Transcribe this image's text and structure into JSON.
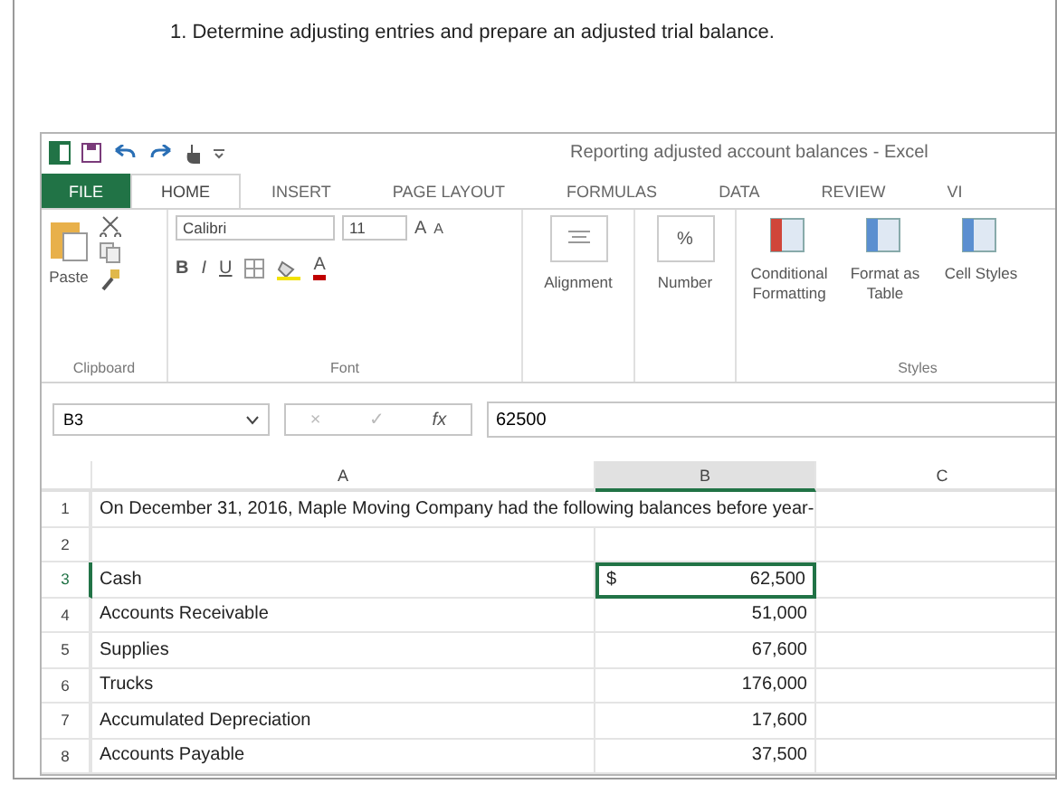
{
  "question": "1. Determine adjusting entries and prepare an adjusted trial balance.",
  "window": {
    "title": "Reporting adjusted account balances - Excel"
  },
  "tabs": [
    {
      "label": "FILE",
      "kind": "file",
      "selected": false
    },
    {
      "label": "HOME",
      "kind": "tab",
      "selected": true
    },
    {
      "label": "INSERT",
      "kind": "tab",
      "selected": false
    },
    {
      "label": "PAGE LAYOUT",
      "kind": "tab",
      "selected": false
    },
    {
      "label": "FORMULAS",
      "kind": "tab",
      "selected": false
    },
    {
      "label": "DATA",
      "kind": "tab",
      "selected": false
    },
    {
      "label": "REVIEW",
      "kind": "tab",
      "selected": false
    },
    {
      "label": "VI",
      "kind": "tab",
      "selected": false
    }
  ],
  "ribbon": {
    "clipboard": {
      "paste": "Paste",
      "label": "Clipboard"
    },
    "font": {
      "name": "Calibri",
      "size": "11",
      "grow": "A",
      "shrink": "A",
      "bold": "B",
      "italic": "I",
      "underline": "U",
      "font_color": "A",
      "label": "Font"
    },
    "alignment": "Alignment",
    "number_symbol": "%",
    "number": "Number",
    "styles": {
      "buttons": [
        "Conditional Formatting",
        "Format as Table",
        "Cell Styles"
      ],
      "label": "Styles"
    }
  },
  "formula_bar": {
    "name_box": "B3",
    "cancel": "×",
    "enter": "✓",
    "fx": "fx",
    "value": "62500"
  },
  "columns": [
    {
      "label": "A",
      "selected": false
    },
    {
      "label": "B",
      "selected": true
    },
    {
      "label": "C",
      "selected": false
    }
  ],
  "rows": [
    {
      "number": "1",
      "a": "On December 31, 2016, Maple Moving Company had the following balances before year-",
      "b": "",
      "selected": false
    },
    {
      "number": "2",
      "a": "",
      "b": "",
      "selected": false
    },
    {
      "number": "3",
      "a": "Cash",
      "currency": "$",
      "b": "62,500",
      "selected": true
    },
    {
      "number": "4",
      "a": "Accounts Receivable",
      "b": "51,000",
      "selected": false
    },
    {
      "number": "5",
      "a": "Supplies",
      "b": "67,600",
      "selected": false
    },
    {
      "number": "6",
      "a": "Trucks",
      "b": "176,000",
      "selected": false
    },
    {
      "number": "7",
      "a": "Accumulated Depreciation",
      "b": "17,600",
      "selected": false
    },
    {
      "number": "8",
      "a": "Accounts Payable",
      "b": "37,500",
      "selected": false
    }
  ]
}
